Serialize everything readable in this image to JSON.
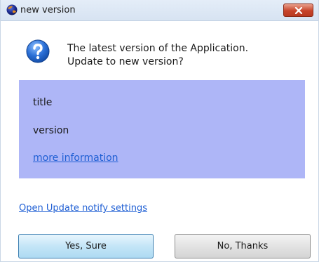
{
  "window": {
    "title": "new version",
    "close_label": "x"
  },
  "message": {
    "line1": "The latest version of the Application.",
    "line2": "Update to new version?"
  },
  "info": {
    "title": "title",
    "version": "version",
    "more_info_link": "more information"
  },
  "settings_link": "Open Update notify settings",
  "buttons": {
    "yes": "Yes, Sure",
    "no": "No, Thanks"
  },
  "colors": {
    "info_panel_bg": "#aeb6f7",
    "link": "#1f5fd4",
    "close_button": "#c7442a",
    "question_icon": "#1f63c6"
  },
  "icons": {
    "app": "app-globe-icon",
    "question": "question-icon",
    "close": "close-icon"
  }
}
